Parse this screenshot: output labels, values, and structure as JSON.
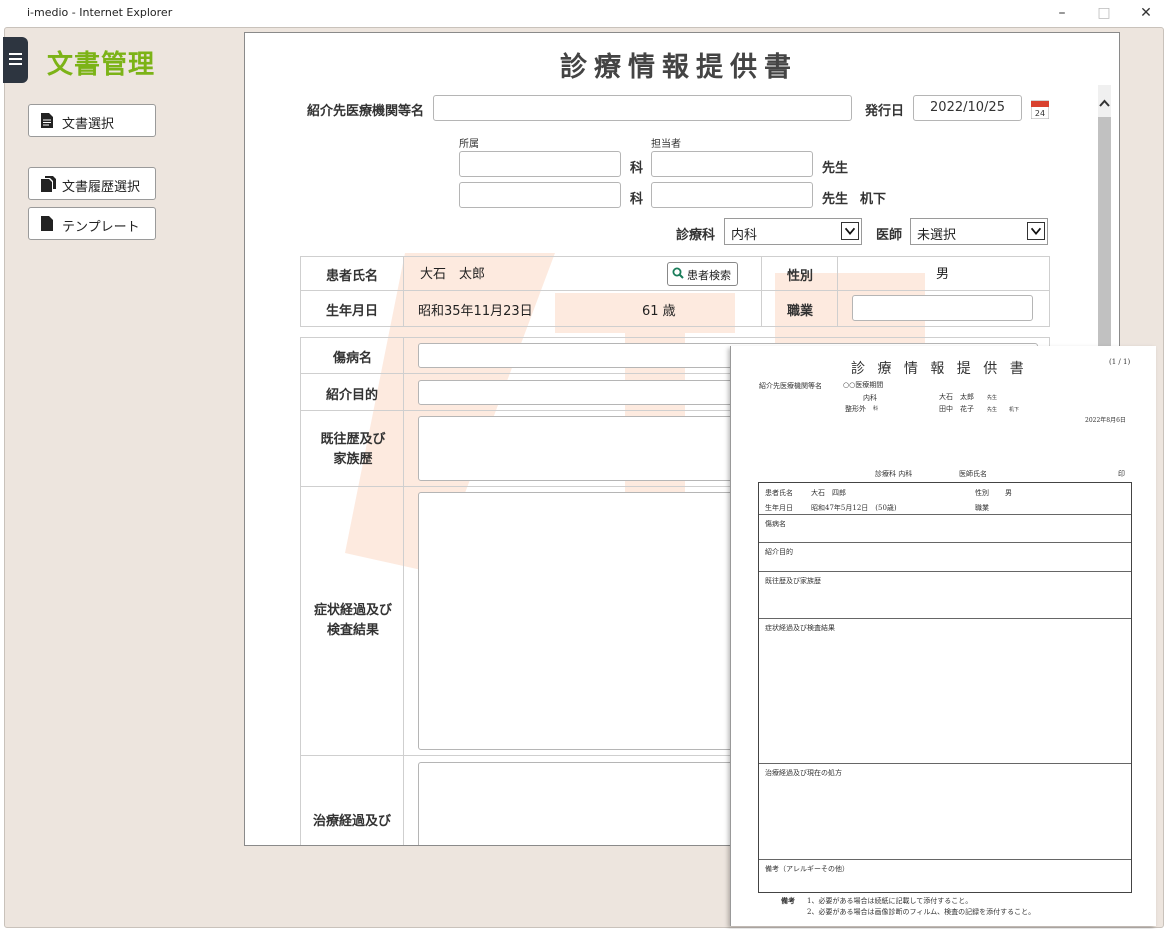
{
  "window": {
    "title": "i-medio - Internet Explorer",
    "minimize": "–",
    "maximize": "□",
    "close": "✕"
  },
  "sidebar": {
    "app_title": "文書管理",
    "items": [
      {
        "label": "文書選択",
        "icon": "document-icon"
      },
      {
        "label": "文書履歴選択",
        "icon": "documents-history-icon"
      },
      {
        "label": "テンプレート",
        "icon": "template-icon"
      }
    ]
  },
  "form": {
    "title": "診療情報提供書",
    "referral_label": "紹介先医療機関等名",
    "referral_value": "",
    "issue_date_label": "発行日",
    "issue_date": "2022/10/25",
    "calendar_day": "24",
    "affiliation_label": "所属",
    "contact_label": "担当者",
    "ka": "科",
    "sensei": "先生",
    "kika": "机下",
    "department_label": "診療科",
    "department_value": "内科",
    "doctor_label": "医師",
    "doctor_value": "未選択",
    "patient": {
      "name_label": "患者氏名",
      "name": "大石　太郎",
      "search_button": "患者検索",
      "sex_label": "性別",
      "sex": "男",
      "birth_label": "生年月日",
      "birth": "昭和35年11月23日",
      "age": "61 歳",
      "job_label": "職業"
    },
    "sections": {
      "injury": "傷病名",
      "purpose": "紹介目的",
      "history": "既往歴及び家族歴",
      "symptoms": "症状経過及び検査結果",
      "treatment": "治療経過及び"
    }
  },
  "preview": {
    "page": "(1 / 1)",
    "title": "診 療 情 報 提 供 書",
    "referral_label": "紹介先医療機関等名",
    "institution": "○○医療期間",
    "dept1": "内科",
    "dept2": "整形外",
    "ka": "科",
    "doc1": "大石　太郎",
    "doc2": "田中　花子",
    "sensei": "先生",
    "kika": "机下",
    "date": "2022年8月6日",
    "shinryoka": "診療科 内科",
    "ishi": "医師氏名",
    "in": "印",
    "name_label": "患者氏名",
    "name": "大石　四郎",
    "sex_label": "性別",
    "sex": "男",
    "birth_label": "生年月日",
    "birth": "昭和47年5月12日　(50歳)",
    "job_label": "職業",
    "injury": "傷病名",
    "purpose": "紹介目的",
    "history": "既往歴及び家族歴",
    "symptoms": "症状経過及び検査結果",
    "treatment": "治療経過及び現在の処方",
    "remarks": "備考（アレルギーその他）",
    "note_label": "備考",
    "note1": "1、必要がある場合は続紙に記載して添付すること。",
    "note2": "2、必要がある場合は画像診断のフィルム、検査の記録を添付すること。"
  },
  "colors": {
    "accent": "#7cb317",
    "watermark": "#fde9dc",
    "menu": "#2d3540"
  }
}
